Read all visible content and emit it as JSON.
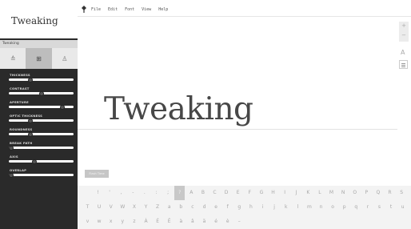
{
  "app": {
    "title": "Tweaking"
  },
  "sidebar": {
    "section_label": "Tweaking",
    "modes": [
      {
        "icon": "pen-nib-icon",
        "glyph": "≙",
        "active": false
      },
      {
        "icon": "grid-icon",
        "glyph": "⊞",
        "active": true
      },
      {
        "icon": "person-icon",
        "glyph": "♙",
        "active": false
      }
    ],
    "sliders": [
      {
        "label": "THICKNESS",
        "value": 0.33
      },
      {
        "label": "CONTRAST",
        "value": 0.5
      },
      {
        "label": "APERTURE",
        "value": 0.83
      },
      {
        "label": "OPTIC THICKNESS",
        "value": 0.33
      },
      {
        "label": "ROUNDNESS",
        "value": 0.33
      },
      {
        "label": "BREAK PATH",
        "value": 0.04
      },
      {
        "label": "AXIS",
        "value": 0.4
      },
      {
        "label": "OVERLAP",
        "value": 0.04
      }
    ]
  },
  "menu": {
    "items": [
      "File",
      "Edit",
      "Font",
      "View",
      "Help"
    ]
  },
  "canvas": {
    "sample_text": "Tweaking",
    "flash_button": "Flash Time"
  },
  "tools": {
    "zoom_in": "+",
    "zoom_out": "−",
    "font_size_icon": "A"
  },
  "glyphs": {
    "rows": [
      [
        "!",
        "'",
        ",",
        "-",
        ".",
        ":",
        ";",
        "?",
        "A",
        "B",
        "C",
        "D",
        "E",
        "F",
        "G",
        "H",
        "I",
        "J",
        "K",
        "L",
        "M",
        "N",
        "O",
        "P",
        "Q",
        "R",
        "S"
      ],
      [
        "T",
        "U",
        "V",
        "W",
        "X",
        "Y",
        "Z",
        "a",
        "b",
        "c",
        "d",
        "e",
        "f",
        "g",
        "h",
        "i",
        "j",
        "k",
        "l",
        "m",
        "n",
        "o",
        "p",
        "q",
        "r",
        "s",
        "t",
        "u"
      ],
      [
        "v",
        "w",
        "x",
        "y",
        "z",
        "À",
        "É",
        "Ê",
        "à",
        "â",
        "ä",
        "é",
        "è",
        "–"
      ]
    ],
    "selected": "?"
  }
}
